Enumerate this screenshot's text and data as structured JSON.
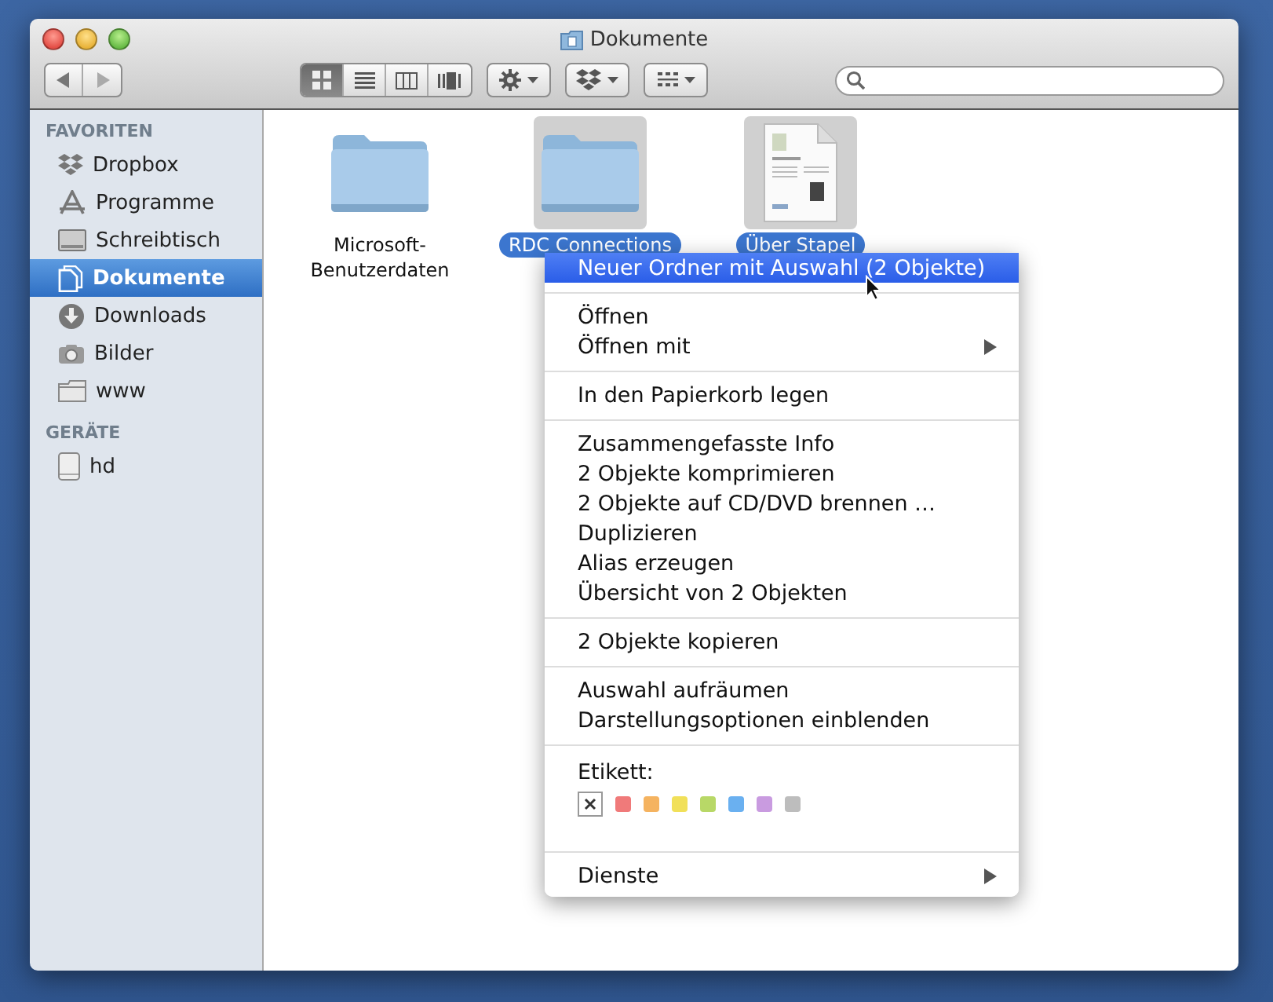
{
  "window": {
    "title": "Dokumente"
  },
  "toolbar": {
    "view_buttons": [
      {
        "kind": "icons",
        "selected": true
      },
      {
        "kind": "list",
        "selected": false
      },
      {
        "kind": "columns",
        "selected": false
      },
      {
        "kind": "coverflow",
        "selected": false
      }
    ]
  },
  "sidebar": {
    "sections": [
      {
        "title": "FAVORITEN",
        "items": [
          {
            "label": "Dropbox",
            "kind": "dropbox",
            "selected": false
          },
          {
            "label": "Programme",
            "kind": "apps",
            "selected": false
          },
          {
            "label": "Schreibtisch",
            "kind": "desktop",
            "selected": false
          },
          {
            "label": "Dokumente",
            "kind": "document",
            "selected": true
          },
          {
            "label": "Downloads",
            "kind": "download",
            "selected": false
          },
          {
            "label": "Bilder",
            "kind": "camera",
            "selected": false
          },
          {
            "label": "www",
            "kind": "folder",
            "selected": false
          }
        ]
      },
      {
        "title": "GERÄTE",
        "items": [
          {
            "label": "hd",
            "kind": "disk",
            "selected": false
          }
        ]
      }
    ]
  },
  "files": [
    {
      "name": "Microsoft-Benutzerdaten",
      "kind": "folder",
      "selected": false
    },
    {
      "name": "RDC Connections",
      "kind": "folder",
      "selected": true
    },
    {
      "name": "Über Stapel",
      "kind": "document",
      "selected": true
    }
  ],
  "context_menu": {
    "items": [
      {
        "kind": "item",
        "label": "Neuer Ordner mit Auswahl (2 Objekte)",
        "selected": true,
        "submenu": false
      },
      {
        "kind": "separator"
      },
      {
        "kind": "item",
        "label": "Öffnen",
        "selected": false,
        "submenu": false
      },
      {
        "kind": "item",
        "label": "Öffnen mit",
        "selected": false,
        "submenu": true
      },
      {
        "kind": "separator"
      },
      {
        "kind": "item",
        "label": "In den Papierkorb legen",
        "selected": false,
        "submenu": false
      },
      {
        "kind": "separator"
      },
      {
        "kind": "item",
        "label": "Zusammengefasste Info",
        "selected": false,
        "submenu": false
      },
      {
        "kind": "item",
        "label": "2 Objekte komprimieren",
        "selected": false,
        "submenu": false
      },
      {
        "kind": "item",
        "label": "2 Objekte auf CD/DVD brennen …",
        "selected": false,
        "submenu": false
      },
      {
        "kind": "item",
        "label": "Duplizieren",
        "selected": false,
        "submenu": false
      },
      {
        "kind": "item",
        "label": "Alias erzeugen",
        "selected": false,
        "submenu": false
      },
      {
        "kind": "item",
        "label": "Übersicht von 2 Objekten",
        "selected": false,
        "submenu": false
      },
      {
        "kind": "separator"
      },
      {
        "kind": "item",
        "label": "2 Objekte kopieren",
        "selected": false,
        "submenu": false
      },
      {
        "kind": "separator"
      },
      {
        "kind": "item",
        "label": "Auswahl aufräumen",
        "selected": false,
        "submenu": false
      },
      {
        "kind": "item",
        "label": "Darstellungsoptionen einblenden",
        "selected": false,
        "submenu": false
      },
      {
        "kind": "separator"
      },
      {
        "kind": "labels",
        "label": "Etikett:",
        "swatches": [
          {
            "color": "#f07a7a"
          },
          {
            "color": "#f5b360"
          },
          {
            "color": "#f1e059"
          },
          {
            "color": "#b8d867"
          },
          {
            "color": "#6ab0f0"
          },
          {
            "color": "#c99be0"
          },
          {
            "color": "#bdbdbd"
          }
        ]
      },
      {
        "kind": "separator"
      },
      {
        "kind": "item",
        "label": "Dienste",
        "selected": false,
        "submenu": true
      }
    ]
  }
}
